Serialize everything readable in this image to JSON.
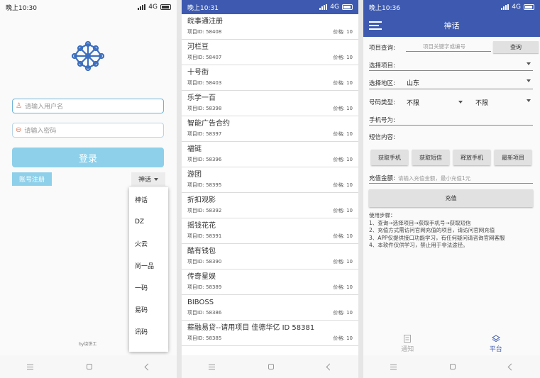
{
  "colors": {
    "accent": "#3d5ab0",
    "button_light": "#8ed0ea"
  },
  "login_screen": {
    "status": {
      "time": "晚上10:30",
      "network": "4G"
    },
    "username_placeholder": "请输入用户名",
    "password_placeholder": "请输入密码",
    "login_button": "登录",
    "register_button": "账号注册",
    "platform_selected": "神话",
    "platform_options": [
      "神话",
      "DZ",
      "火云",
      "尚一品",
      "一码",
      "易码",
      "讯码",
      "..."
    ],
    "byline": "by烧饼工"
  },
  "project_list": {
    "status": {
      "time": "晚上10:31",
      "network": "4G"
    },
    "id_label": "项目ID:",
    "price_label": "价格:",
    "items": [
      {
        "name": "皖事通注册",
        "id": "58408",
        "price": "10"
      },
      {
        "name": "河栏豆",
        "id": "58407",
        "price": "10"
      },
      {
        "name": "十号街",
        "id": "58403",
        "price": "10"
      },
      {
        "name": "乐学一百",
        "id": "58398",
        "price": "10"
      },
      {
        "name": "智能广告合约",
        "id": "58397",
        "price": "10"
      },
      {
        "name": "福链",
        "id": "58396",
        "price": "10"
      },
      {
        "name": "游团",
        "id": "58395",
        "price": "10"
      },
      {
        "name": "折扣观影",
        "id": "58392",
        "price": "10"
      },
      {
        "name": "摇钱花花",
        "id": "58391",
        "price": "10"
      },
      {
        "name": "酷有钱包",
        "id": "58390",
        "price": "10"
      },
      {
        "name": "传奇星娱",
        "id": "58389",
        "price": "10"
      },
      {
        "name": "BIBOSS",
        "id": "58386",
        "price": "10"
      },
      {
        "name": "薪融易贷--请用项目 佳德华亿 ID 58381",
        "id": "58385",
        "price": "10"
      }
    ]
  },
  "platform_screen": {
    "status": {
      "time": "晚上10:36",
      "network": "4G"
    },
    "title": "神话",
    "query_label": "项目查询:",
    "query_placeholder": "项目关键字或编号",
    "query_button": "查询",
    "select_project_label": "选择项目:",
    "select_region_label": "选择地区:",
    "region_value": "山东",
    "number_type_label": "号码类型:",
    "number_type_value1": "不限",
    "number_type_value2": "不限",
    "phone_label": "手机号为:",
    "sms_label": "短信内容:",
    "action_buttons": [
      "获取手机",
      "获取短信",
      "释放手机",
      "最新项目"
    ],
    "recharge_label": "充值金额:",
    "recharge_placeholder": "请输入充值金额，最小充值1元",
    "recharge_button": "充值",
    "steps_title": "使用步骤：",
    "steps": [
      "1、查询→选择项目→获取手机号→获取短信",
      "2、充值方式需访问官网充值的项目，请访问官网充值",
      "3、APP仅提供接口功能学习，有任何疑问请咨询官网客服",
      "4、本软件仅供学习，禁止用于非法途径。"
    ],
    "tabs": [
      {
        "label": "通知",
        "active": false
      },
      {
        "label": "平台",
        "active": true
      }
    ]
  }
}
